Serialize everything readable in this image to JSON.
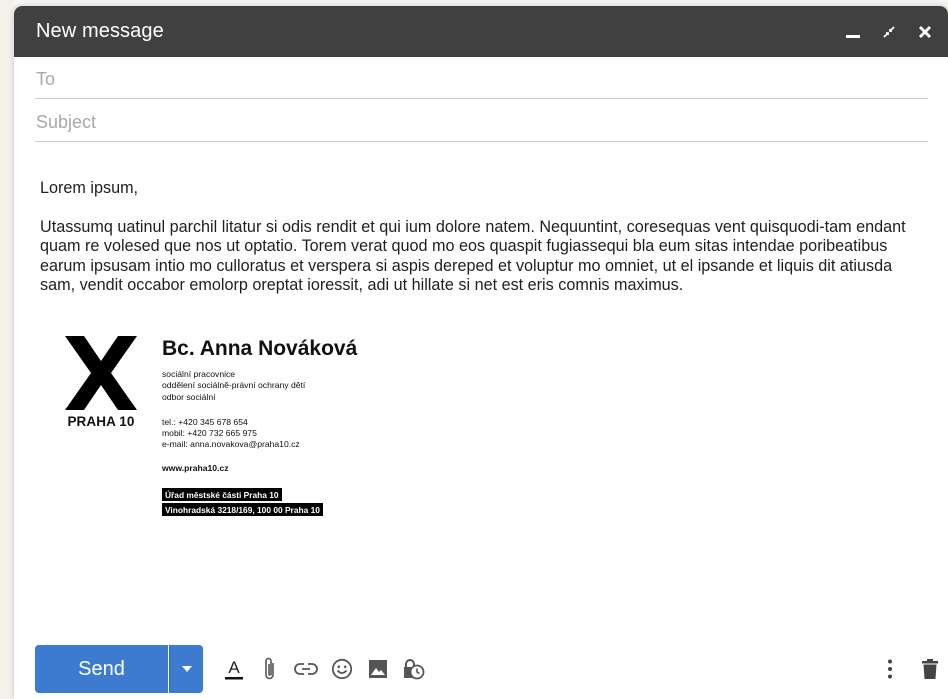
{
  "window": {
    "title": "New message"
  },
  "fields": {
    "to_placeholder": "To",
    "subject_placeholder": "Subject"
  },
  "message": {
    "greeting": "Lorem ipsum,",
    "paragraph": "Utassumq uatinul parchil litatur si odis rendit et qui ium dolore natem. Nequuntint, coresequas vent quisquodi-tam endant quam re volesed que nos ut optatio. Torem verat quod mo eos quaspit fugiassequi bla eum sitas intendae poribeatibus earum ipsusam intio mo culloratus et verspera si aspis dereped et voluptur mo omniet, ut el ipsande et liquis dit atiusda sam, vendit occabor emolorp oreptat ioressit, adi ut hillate si net est eris comnis maximus."
  },
  "signature": {
    "logo_text": "PRAHA 10",
    "name": "Bc. Anna Nováková",
    "roles": [
      "sociální pracovnice",
      "oddělení sociálně-právní ochrany dětí",
      "odbor sociální"
    ],
    "contacts": [
      "tel.: +420 345 678 654",
      "mobil: +420 732 665 975",
      "e-mail: anna.novakova@praha10.cz"
    ],
    "web": "www.praha10.cz",
    "address": [
      "Úřad městské části Praha 10",
      "Vinohradská 3218/169, 100 00 Praha 10"
    ]
  },
  "toolbar": {
    "send_label": "Send",
    "icons": [
      "formatting-icon",
      "attach-icon",
      "link-icon",
      "emoji-icon",
      "photo-icon",
      "confidential-icon",
      "more-options-icon",
      "trash-icon"
    ]
  },
  "colors": {
    "titlebar": "#404040",
    "send": "#3d7bd0"
  }
}
